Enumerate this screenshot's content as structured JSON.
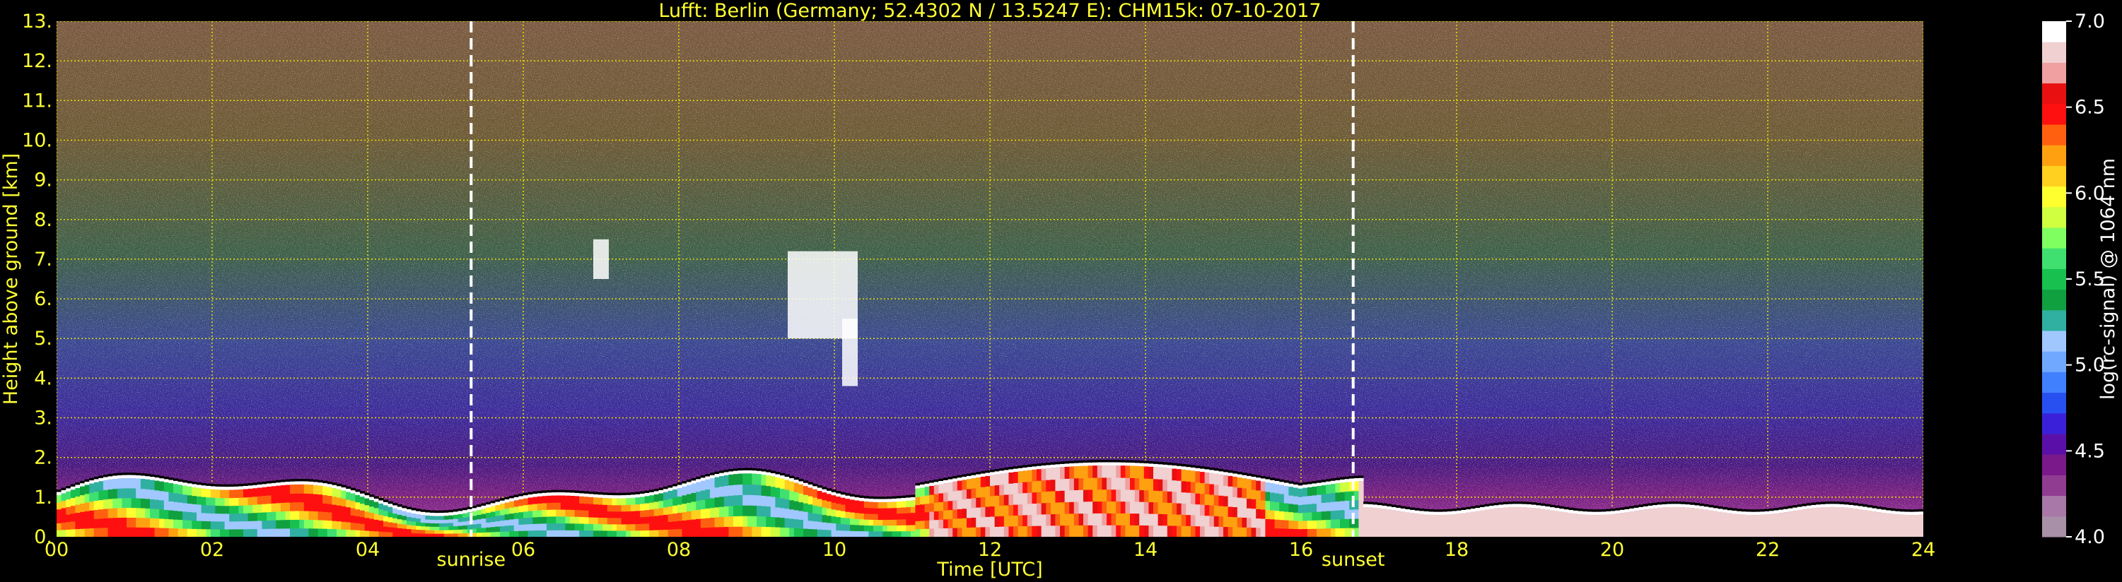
{
  "chart_data": {
    "type": "heatmap",
    "title": "Lufft: Berlin (Germany; 52.4302 N / 13.5247 E):    CHM15k: 07-10-2017",
    "xlabel": "Time [UTC]",
    "ylabel": "Height above ground [km]",
    "xlim": [
      0,
      24
    ],
    "ylim": [
      0,
      13
    ],
    "x_ticks": [
      "00",
      "02",
      "04",
      "06",
      "08",
      "10",
      "12",
      "14",
      "16",
      "18",
      "20",
      "22",
      "24"
    ],
    "y_ticks": [
      "0.",
      "1.",
      "2.",
      "3.",
      "4.",
      "5.",
      "6.",
      "7.",
      "8.",
      "9.",
      "10.",
      "11.",
      "12.",
      "13."
    ],
    "grid": true,
    "events": [
      {
        "label": "sunrise",
        "time": 5.33
      },
      {
        "label": "sunset",
        "time": 16.67
      }
    ],
    "colorbar": {
      "label": "log(rc-signal) @ 1064 nm",
      "range": [
        4.0,
        7.0
      ],
      "ticks": [
        "4.0",
        "4.5",
        "5.0",
        "5.5",
        "6.0",
        "6.5",
        "7.0"
      ],
      "colors": [
        "#a890a8",
        "#a878a8",
        "#903c90",
        "#7a1a8a",
        "#5a10a8",
        "#3a20d8",
        "#2850f0",
        "#4080ff",
        "#70a8ff",
        "#a0c8ff",
        "#30b0a0",
        "#10a040",
        "#18c050",
        "#40e070",
        "#80ff60",
        "#d0ff40",
        "#ffff30",
        "#ffd020",
        "#ffa010",
        "#ff6010",
        "#ff1010",
        "#e81010",
        "#f0a0a0",
        "#f0d0d0",
        "#ffffff"
      ]
    },
    "layers": [
      {
        "name": "cloud",
        "t0": 9.4,
        "t1": 10.3,
        "h0": 5.0,
        "h1": 7.2
      },
      {
        "name": "cloud",
        "t0": 10.1,
        "t1": 10.3,
        "h0": 3.8,
        "h1": 5.5
      },
      {
        "name": "cloud",
        "t0": 6.9,
        "t1": 7.1,
        "h0": 6.5,
        "h1": 7.5
      }
    ]
  }
}
